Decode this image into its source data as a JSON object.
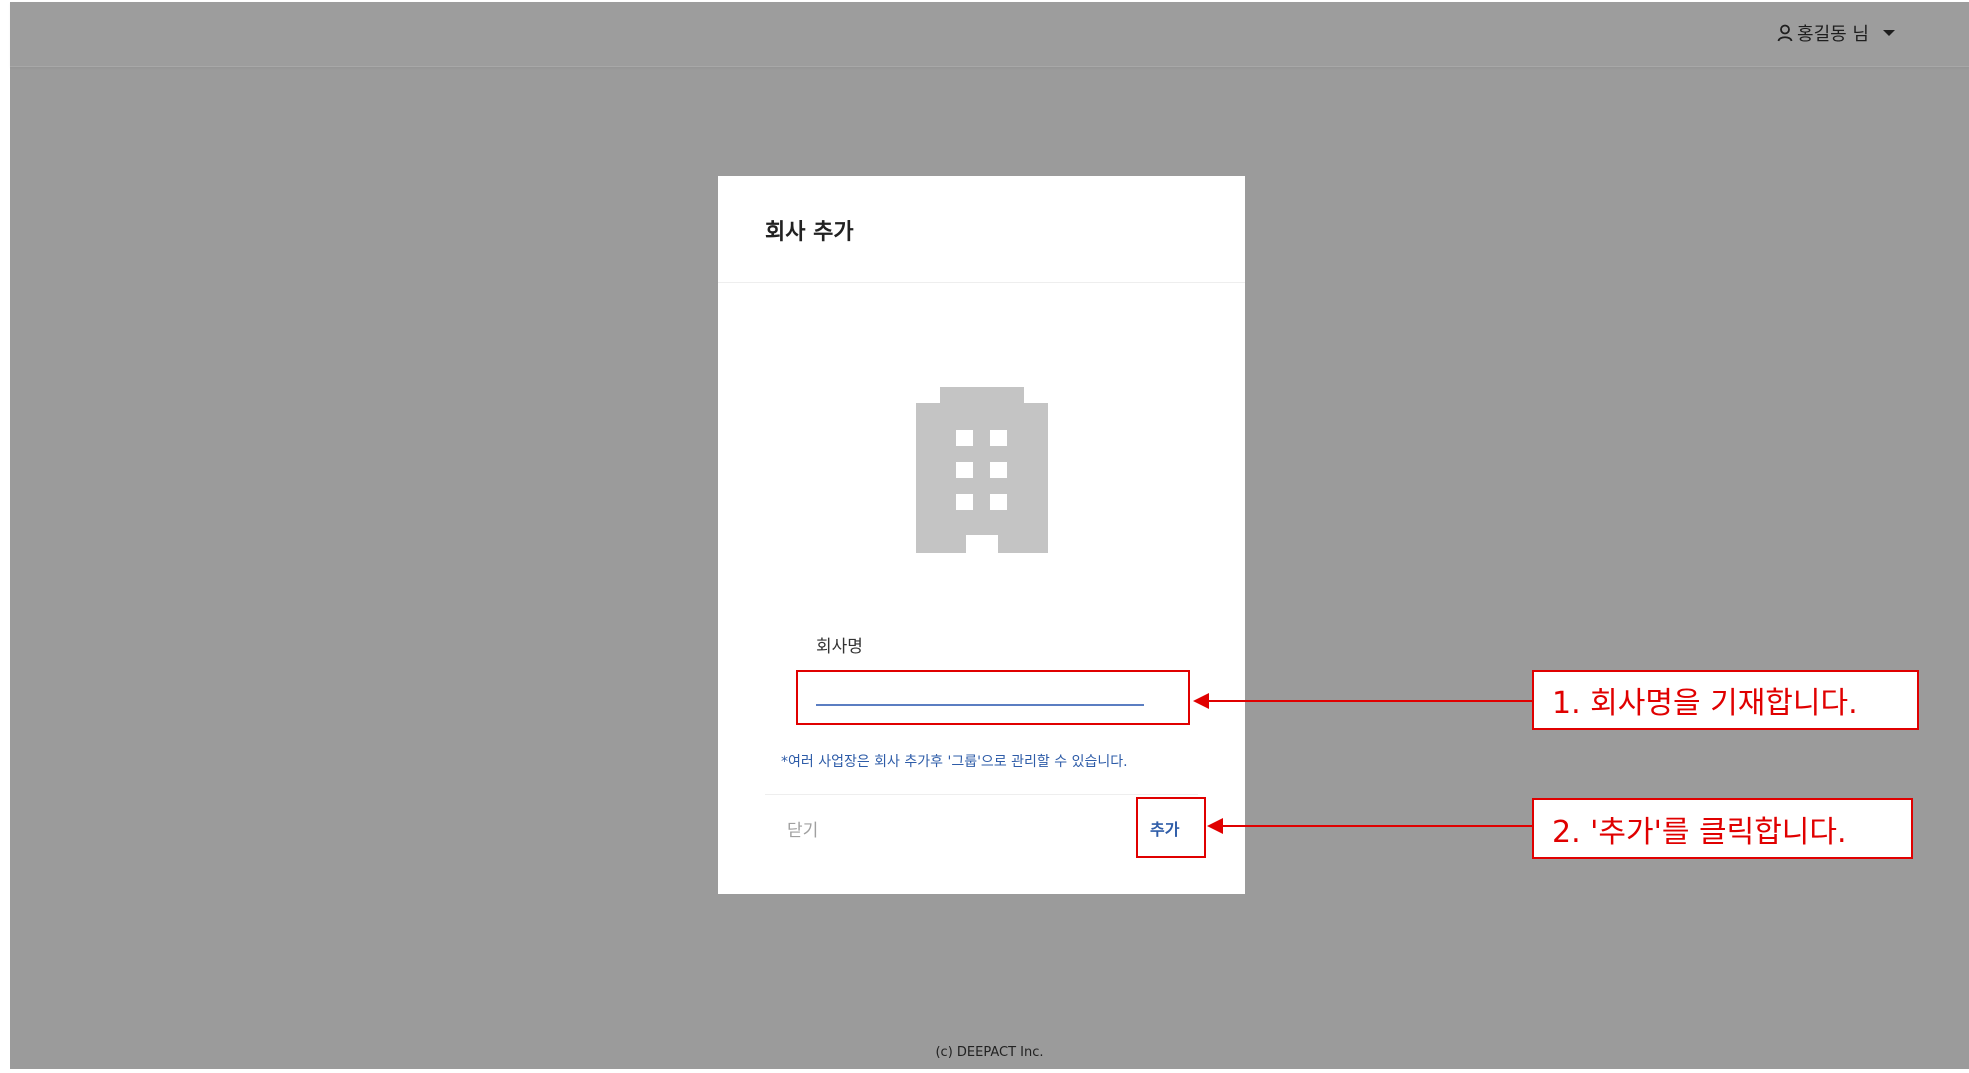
{
  "header": {
    "user_name": "홍길동 님",
    "user_icon": "user-icon",
    "menu_icon": "caret-down-icon"
  },
  "modal": {
    "title": "회사 추가",
    "illustration_icon": "building-icon",
    "field_label": "회사명",
    "company_name_value": "",
    "hint": "*여러 사업장은 회사 추가후 '그룹'으로 관리할 수 있습니다.",
    "close_label": "닫기",
    "add_label": "추가"
  },
  "footer": {
    "copyright": "(c) DEEPACT Inc."
  },
  "annotations": {
    "step1": "1. 회사명을 기재합니다.",
    "step2": "2. '추가'를 클릭합니다.",
    "color": "#e00000"
  },
  "colors": {
    "overlay": "#9b9b9b",
    "accent": "#2e5ca8",
    "icon_gray": "#c4c4c4"
  }
}
